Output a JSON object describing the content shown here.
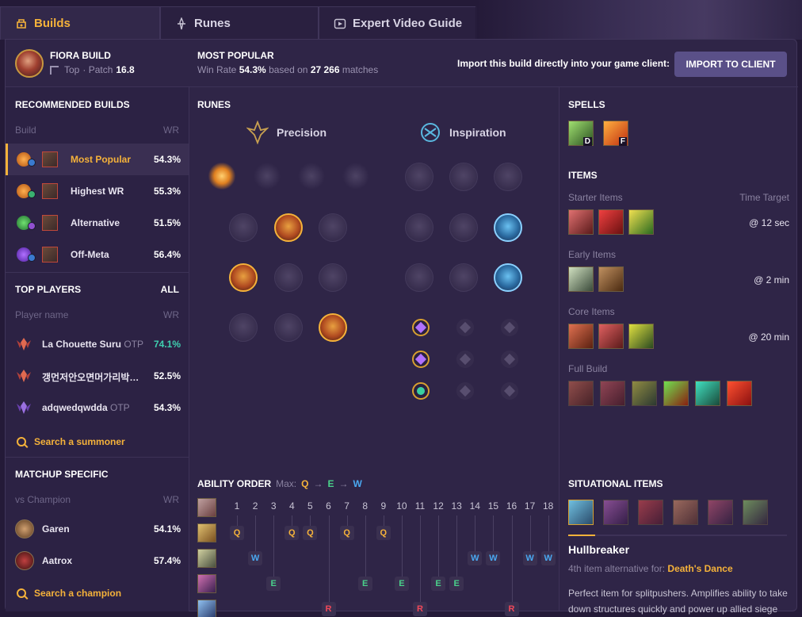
{
  "tabs": [
    {
      "label": "Builds",
      "icon": "builds-icon"
    },
    {
      "label": "Runes",
      "icon": "runes-icon"
    },
    {
      "label": "Expert Video Guide",
      "icon": "video-icon"
    }
  ],
  "header": {
    "champion_name": "FIORA BUILD",
    "role": "Top",
    "patch_label": "· Patch",
    "patch": "16.8",
    "most_popular_title": "MOST POPULAR",
    "win_rate_label": "Win Rate",
    "win_rate": "54.3%",
    "based_on": "based on",
    "matches": "27 266",
    "matches_label": "matches",
    "import_label": "Import this build directly into your game client:",
    "import_button": "IMPORT TO CLIENT"
  },
  "recommended": {
    "title": "RECOMMENDED BUILDS",
    "col_build": "Build",
    "col_wr": "WR",
    "builds": [
      {
        "name": "Most Popular",
        "wr": "54.3%",
        "active": true
      },
      {
        "name": "Highest WR",
        "wr": "55.3%",
        "active": false
      },
      {
        "name": "Alternative",
        "wr": "51.5%",
        "active": false
      },
      {
        "name": "Off-Meta",
        "wr": "56.4%",
        "active": false
      }
    ]
  },
  "top_players": {
    "title": "TOP PLAYERS",
    "all_label": "ALL",
    "col_name": "Player name",
    "col_wr": "WR",
    "players": [
      {
        "name": "La Chouette Suru",
        "tag": "OTP",
        "wr": "74.1%",
        "wr_color": "#3fd0b0"
      },
      {
        "name": "갱먼저안오면머가리박…",
        "tag": "",
        "wr": "52.5%",
        "wr_color": "#ffffff"
      },
      {
        "name": "adqwedqwdda",
        "tag": "OTP",
        "wr": "54.3%",
        "wr_color": "#ffffff"
      }
    ],
    "search_label": "Search a summoner"
  },
  "matchup": {
    "title": "MATCHUP SPECIFIC",
    "col_vs": "vs Champion",
    "col_wr": "WR",
    "champions": [
      {
        "name": "Garen",
        "wr": "54.1%"
      },
      {
        "name": "Aatrox",
        "wr": "57.4%"
      }
    ],
    "search_label": "Search a champion"
  },
  "runes": {
    "title": "RUNES",
    "primary_tree": "Precision",
    "secondary_tree": "Inspiration"
  },
  "ability_order": {
    "title": "ABILITY ORDER",
    "max_label": "Max:",
    "max_order": [
      "Q",
      "E",
      "W"
    ],
    "arrow": "→",
    "levels": [
      "1",
      "2",
      "3",
      "4",
      "5",
      "6",
      "7",
      "8",
      "9",
      "10",
      "11",
      "12",
      "13",
      "14",
      "15",
      "16",
      "17",
      "18"
    ],
    "sequence": [
      "Q",
      "W",
      "E",
      "Q",
      "Q",
      "R",
      "Q",
      "E",
      "Q",
      "E",
      "R",
      "E",
      "E",
      "W",
      "W",
      "R",
      "W",
      "W"
    ]
  },
  "spells": {
    "title": "SPELLS",
    "list": [
      {
        "key": "D",
        "name": "Ghost"
      },
      {
        "key": "F",
        "name": "Flash"
      }
    ]
  },
  "items": {
    "title": "ITEMS",
    "time_target_label": "Time Target",
    "groups": [
      {
        "label": "Starter Items",
        "time": "@ 12 sec"
      },
      {
        "label": "Early Items",
        "time": "@ 2 min"
      },
      {
        "label": "Core Items",
        "time": "@ 20 min"
      },
      {
        "label": "Full Build",
        "time": ""
      }
    ]
  },
  "situational": {
    "title": "SITUATIONAL ITEMS",
    "selected_name": "Hullbreaker",
    "alt_prefix": "4th item alternative for:",
    "alt_item": "Death's Dance",
    "description": "Perfect item for splitpushers. Amplifies ability to take down structures quickly and power up allied siege and super minions."
  },
  "colors": {
    "accent": "#f5b23a",
    "background": "#2f2547",
    "q": "#f5b23a",
    "w": "#4aa8f0",
    "e": "#4ad08a",
    "r": "#f0485a"
  }
}
